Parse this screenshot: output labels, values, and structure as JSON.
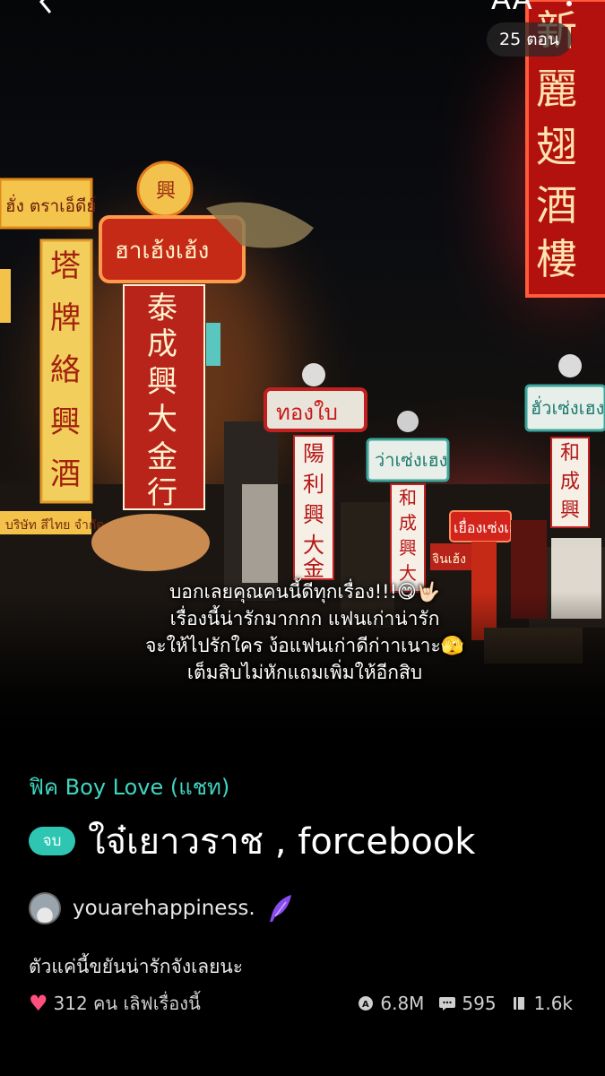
{
  "header": {
    "back_icon": "chevron-left-icon",
    "font_label": "AA",
    "more_icon": "more-vertical-icon",
    "episode_badge": "25 ตอน"
  },
  "cover": {
    "blurb_lines": [
      "บอกเลยคุณคนนี้ดีทุกเรื่อง!!!😋🤟🏻",
      "เรื่องนี้น่ารักมากกก แฟนเก่าน่ารัก",
      "จะให้ไปรักใคร ง้อแฟนเก่าดีก่าาเนาะ🫣",
      "เต็มสิบไม่หักแถมเพิ่มให้อีกสิบ"
    ],
    "sign_texts": [
      "ฮั่ง ตราเอ็ดีย์",
      "ฮาเฮ้งเฮ้ง",
      "ทองใบ",
      "ว่าเซ่งเฮง",
      "ฮั่วเซ่งเฮง",
      "เยื่องเซ่งเฮง",
      "จินเฮ้ง"
    ],
    "accent_color": "#ff3b2f"
  },
  "story": {
    "genre": "ฟิค Boy Love (แชท)",
    "status_badge": "จบ",
    "title": "ใจ๋เยาวราช , forcebook",
    "author": "youarehappiness.",
    "writer_badge_icon": "quill-feather-icon",
    "description": "ตัวแค่นี้ขยันน่ารักจังเลยนะ"
  },
  "stats": {
    "likes": "312 คน เลิฟเรื่องนี้",
    "views": "6.8M",
    "comments": "595",
    "library": "1.6k"
  },
  "colors": {
    "teal": "#3fd6c0",
    "badge": "#2ec6b3",
    "heart": "#ff4f7d"
  }
}
